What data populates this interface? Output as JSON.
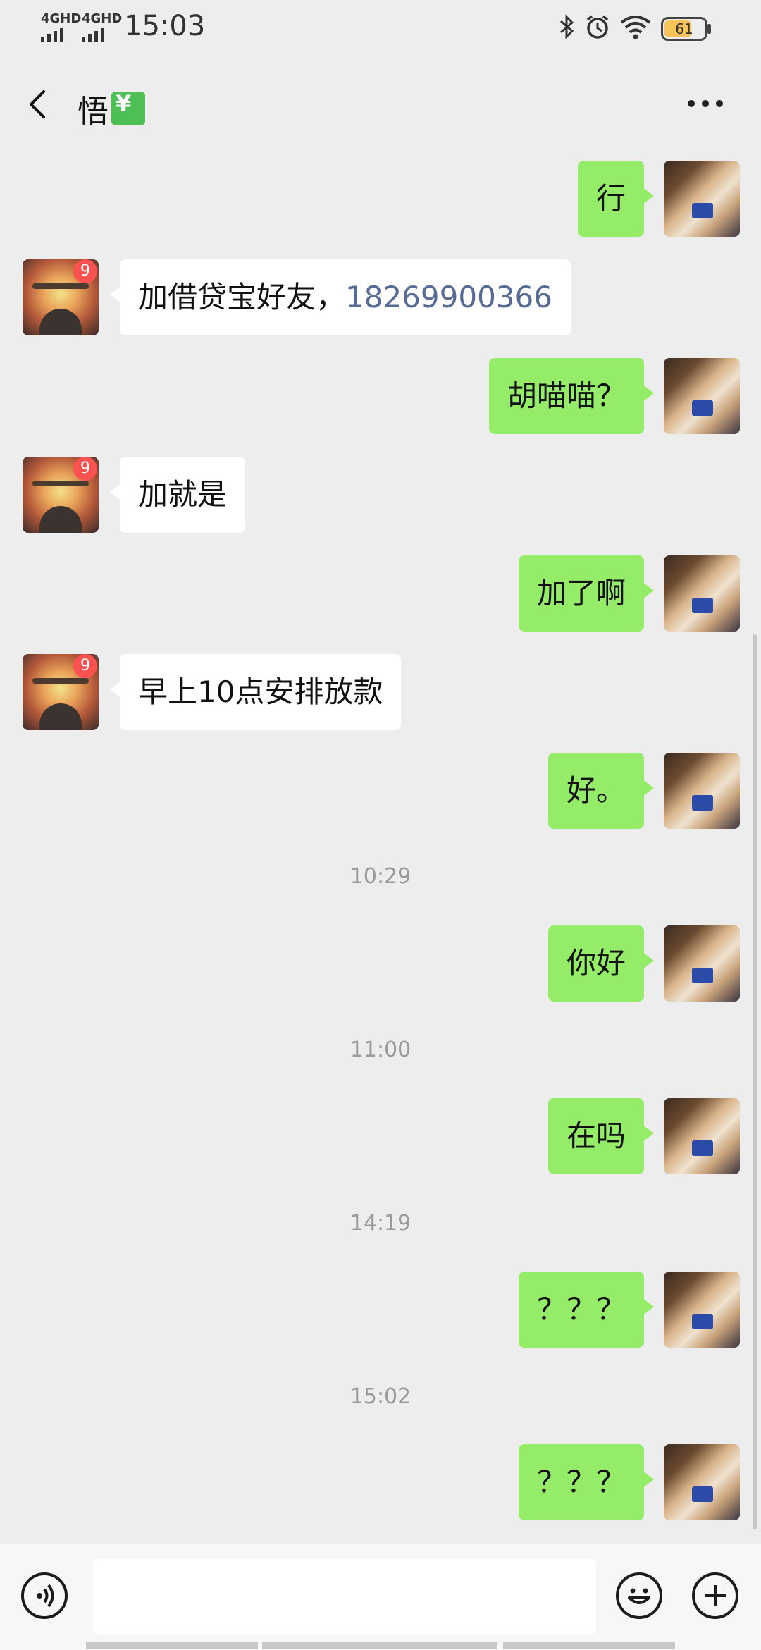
{
  "status_bar": {
    "signal_1": "4GHD",
    "signal_2": "4GHD",
    "time": "15:03",
    "battery": "61"
  },
  "header": {
    "title": "悟",
    "title_emoji_glyph": "¥"
  },
  "messages": [
    {
      "from": "me",
      "text": "行"
    },
    {
      "from": "other",
      "text": "加借贷宝好友，",
      "phone": "18269900366",
      "badge": "9"
    },
    {
      "from": "me",
      "text": "胡喵喵？"
    },
    {
      "from": "other",
      "text": "加就是",
      "badge": "9"
    },
    {
      "from": "me",
      "text": "加了啊"
    },
    {
      "from": "other",
      "text": "早上10点安排放款",
      "badge": "9"
    },
    {
      "from": "me",
      "text": "好。"
    },
    {
      "time": "10:29"
    },
    {
      "from": "me",
      "text": "你好"
    },
    {
      "time": "11:00"
    },
    {
      "from": "me",
      "text": "在吗"
    },
    {
      "time": "14:19"
    },
    {
      "from": "me",
      "text": "？？？"
    },
    {
      "time": "15:02"
    },
    {
      "from": "me",
      "text": "？？？"
    }
  ],
  "input": {
    "placeholder": ""
  },
  "colors": {
    "background": "#ededed",
    "my_bubble": "#95ec69",
    "other_bubble": "#ffffff",
    "link": "#576b95",
    "badge": "#fa5151"
  },
  "icons": [
    "back-arrow-icon",
    "more-dots-icon",
    "voice-icon",
    "emoji-icon",
    "plus-icon",
    "bluetooth-icon",
    "alarm-icon",
    "wifi-icon",
    "battery-icon"
  ]
}
